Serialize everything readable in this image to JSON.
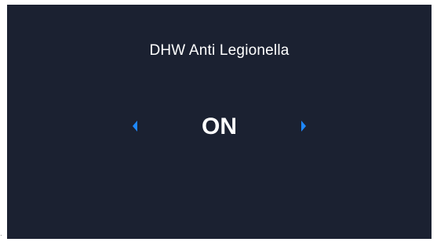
{
  "screen": {
    "title": "DHW Anti Legionella",
    "value": "ON",
    "left_arrow_icon": "caret-left-icon",
    "right_arrow_icon": "caret-right-icon"
  },
  "colors": {
    "background": "#1b2131",
    "text": "#ffffff",
    "accent": "#1e88ff"
  }
}
